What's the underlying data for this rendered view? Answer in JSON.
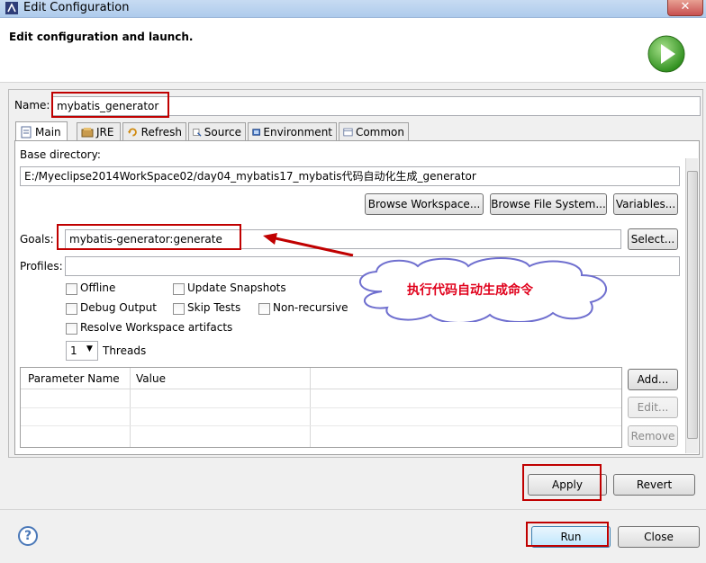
{
  "window": {
    "title": "Edit Configuration",
    "close_glyph": "✕"
  },
  "header": {
    "heading": "Edit configuration and launch."
  },
  "name_field": {
    "label": "Name:",
    "value": "mybatis_generator"
  },
  "tabs": [
    {
      "label": "Main",
      "icon": "document-icon"
    },
    {
      "label": "JRE",
      "icon": "java-library-icon"
    },
    {
      "label": "Refresh",
      "icon": "refresh-icon"
    },
    {
      "label": "Source",
      "icon": "source-icon"
    },
    {
      "label": "Environment",
      "icon": "environment-icon"
    },
    {
      "label": "Common",
      "icon": "common-icon"
    }
  ],
  "main": {
    "base_dir_label": "Base directory:",
    "base_dir_value": "E:/Myeclipse2014WorkSpace02/day04_mybatis17_mybatis代码自动化生成_generator",
    "browse_workspace": "Browse Workspace...",
    "browse_filesystem": "Browse File System...",
    "variables": "Variables...",
    "goals_label": "Goals:",
    "goals_value": "mybatis-generator:generate",
    "select": "Select...",
    "profiles_label": "Profiles:",
    "profiles_value": "",
    "checkboxes": {
      "offline": "Offline",
      "update_snapshots": "Update Snapshots",
      "debug_output": "Debug Output",
      "skip_tests": "Skip Tests",
      "non_recursive": "Non-recursive",
      "resolve_workspace": "Resolve Workspace artifacts"
    },
    "threads_value": "1",
    "threads_label": "Threads",
    "table_headers": [
      "Parameter Name",
      "Value"
    ],
    "add": "Add...",
    "edit": "Edit...",
    "remove": "Remove"
  },
  "annotation": {
    "text": "执行代码自动生成命令"
  },
  "buttons": {
    "apply": "Apply",
    "revert": "Revert",
    "run": "Run",
    "close": "Close"
  },
  "colors": {
    "highlight_box": "#c00000",
    "callout_text": "#e0001b",
    "arrow": "#c00000"
  }
}
